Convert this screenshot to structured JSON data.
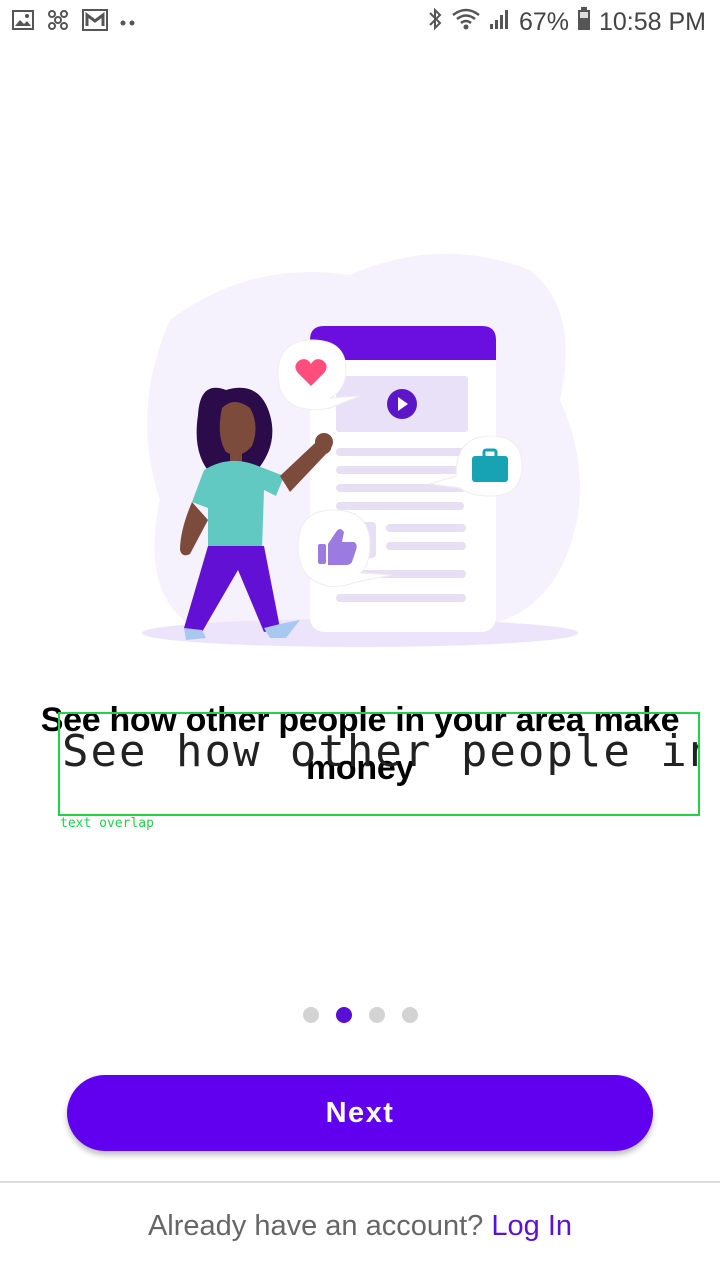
{
  "status_bar": {
    "battery_percent": "67%",
    "time": "10:58 PM",
    "icons_left": [
      "gallery-icon",
      "pinwheel-icon",
      "gmail-icon",
      "more-dots-icon"
    ],
    "icons_right": [
      "bluetooth-icon",
      "wifi-icon",
      "signal-icon",
      "battery-icon"
    ]
  },
  "onboarding": {
    "title": "See how other people in your area make money",
    "overlay_text": "See how other people in yo",
    "overlay_label": "text overlap",
    "page_count": 4,
    "current_page": 2
  },
  "actions": {
    "next_label": "Next"
  },
  "footer": {
    "prompt": "Already have an account?",
    "login_label": "Log In"
  },
  "colors": {
    "primary": "#6100ee",
    "dot_active": "#5a0fd6",
    "dot_inactive": "#d3d3d3",
    "overlay": "#23d14a"
  }
}
